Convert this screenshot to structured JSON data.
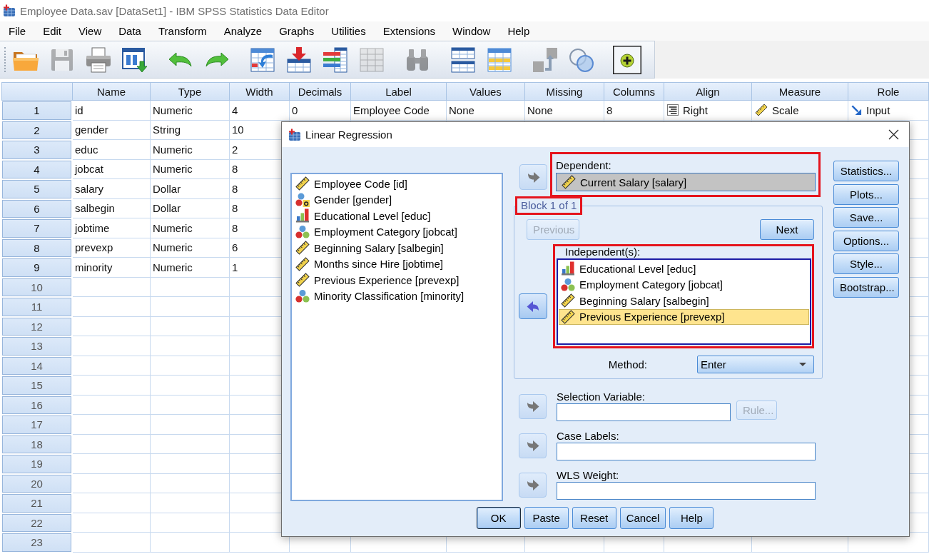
{
  "window": {
    "title": "Employee Data.sav [DataSet1] - IBM SPSS Statistics Data Editor"
  },
  "menu": [
    "File",
    "Edit",
    "View",
    "Data",
    "Transform",
    "Analyze",
    "Graphs",
    "Utilities",
    "Extensions",
    "Window",
    "Help"
  ],
  "toolbar": {
    "groups": [
      [
        {
          "kind": "folder",
          "disabled": false,
          "pressed": false
        },
        {
          "kind": "disk",
          "disabled": true,
          "pressed": false
        },
        {
          "kind": "printer",
          "disabled": false,
          "pressed": false
        },
        {
          "kind": "panel",
          "disabled": false,
          "pressed": false
        }
      ],
      [
        {
          "kind": "undo",
          "disabled": false,
          "pressed": false
        },
        {
          "kind": "redo",
          "disabled": false,
          "pressed": false
        }
      ],
      [
        {
          "kind": "jump",
          "disabled": false,
          "pressed": false
        },
        {
          "kind": "insert",
          "disabled": false,
          "pressed": false
        },
        {
          "kind": "columns",
          "disabled": false,
          "pressed": false
        },
        {
          "kind": "grid",
          "disabled": true,
          "pressed": false
        }
      ],
      [
        {
          "kind": "binoculars",
          "disabled": true,
          "pressed": false
        }
      ],
      [
        {
          "kind": "split",
          "disabled": false,
          "pressed": false
        },
        {
          "kind": "sheet",
          "disabled": false,
          "pressed": false
        }
      ],
      [
        {
          "kind": "labels",
          "disabled": false,
          "pressed": false
        },
        {
          "kind": "circles",
          "disabled": false,
          "pressed": false
        }
      ],
      [
        {
          "kind": "plus",
          "disabled": false,
          "pressed": true
        }
      ]
    ]
  },
  "data_editor": {
    "columns": [
      "Name",
      "Type",
      "Width",
      "Decimals",
      "Label",
      "Values",
      "Missing",
      "Columns",
      "Align",
      "Measure",
      "Role"
    ],
    "rows": [
      {
        "number": "1",
        "cells": [
          "id",
          "Numeric",
          "4",
          "0",
          "Employee Code",
          "None",
          "None",
          "8",
          {
            "text": "Right",
            "kind": "align"
          },
          {
            "text": "Scale",
            "kind": "measure"
          },
          {
            "text": "Input",
            "kind": "role"
          }
        ]
      },
      {
        "number": "2",
        "cells": [
          "gender",
          "String",
          "10"
        ]
      },
      {
        "number": "3",
        "cells": [
          "educ",
          "Numeric",
          "2"
        ]
      },
      {
        "number": "4",
        "cells": [
          "jobcat",
          "Numeric",
          "8"
        ]
      },
      {
        "number": "5",
        "cells": [
          "salary",
          "Dollar",
          "8"
        ]
      },
      {
        "number": "6",
        "cells": [
          "salbegin",
          "Dollar",
          "8"
        ]
      },
      {
        "number": "7",
        "cells": [
          "jobtime",
          "Numeric",
          "8"
        ]
      },
      {
        "number": "8",
        "cells": [
          "prevexp",
          "Numeric",
          "6"
        ]
      },
      {
        "number": "9",
        "cells": [
          "minority",
          "Numeric",
          "1"
        ]
      },
      {
        "number": "10"
      },
      {
        "number": "11"
      },
      {
        "number": "12"
      },
      {
        "number": "13"
      },
      {
        "number": "14"
      },
      {
        "number": "15"
      },
      {
        "number": "16"
      },
      {
        "number": "17"
      },
      {
        "number": "18"
      },
      {
        "number": "19"
      },
      {
        "number": "20"
      },
      {
        "number": "21"
      },
      {
        "number": "22"
      },
      {
        "number": "23"
      }
    ]
  },
  "dialog": {
    "title": "Linear Regression",
    "variables": [
      {
        "label": "Employee Code [id]",
        "kind": "scale",
        "selected": false
      },
      {
        "label": "Gender [gender]",
        "kind": "string",
        "selected": false
      },
      {
        "label": "Educational Level [educ]",
        "kind": "ordinal",
        "selected": false
      },
      {
        "label": "Employment Category [jobcat]",
        "kind": "nominal",
        "selected": false
      },
      {
        "label": "Beginning Salary [salbegin]",
        "kind": "scale",
        "selected": false
      },
      {
        "label": "Months since Hire [jobtime]",
        "kind": "scale",
        "selected": false
      },
      {
        "label": "Previous Experience [prevexp]",
        "kind": "scale",
        "selected": false
      },
      {
        "label": "Minority Classification [minority]",
        "kind": "nominal",
        "selected": false
      }
    ],
    "dependent": {
      "label": "Dependent:",
      "highlighted": true,
      "move": {
        "kind": "forward",
        "active": false
      },
      "variable": {
        "label": "Current Salary [salary]",
        "kind": "scale"
      }
    },
    "block": {
      "label": "Block 1 of 1",
      "highlighted": true,
      "previous": {
        "label": "Previous",
        "disabled": true
      },
      "next": {
        "label": "Next",
        "disabled": false
      },
      "independents": {
        "label": "Independent(s):",
        "highlighted": true,
        "move": {
          "kind": "back",
          "active": true
        },
        "variables": [
          {
            "label": "Educational Level [educ]",
            "kind": "ordinal",
            "selected": false
          },
          {
            "label": "Employment Category [jobcat]",
            "kind": "nominal",
            "selected": false
          },
          {
            "label": "Beginning Salary [salbegin]",
            "kind": "scale",
            "selected": false
          },
          {
            "label": "Previous Experience [prevexp]",
            "kind": "scale",
            "selected": true
          }
        ]
      },
      "method": {
        "label": "Method:",
        "value": "Enter"
      }
    },
    "selection_variable": {
      "label": "Selection Variable:",
      "move": {
        "kind": "forward",
        "active": false
      },
      "rule": {
        "label": "Rule...",
        "disabled": true
      }
    },
    "case_labels": {
      "label": "Case Labels:",
      "move": {
        "kind": "forward",
        "active": false
      }
    },
    "wls_weight": {
      "label": "WLS Weight:",
      "move": {
        "kind": "forward",
        "active": false
      }
    },
    "side_buttons": [
      "Statistics...",
      "Plots...",
      "Save...",
      "Options...",
      "Style...",
      "Bootstrap..."
    ],
    "buttons": [
      {
        "label": "OK",
        "default": true
      },
      {
        "label": "Paste",
        "default": false
      },
      {
        "label": "Reset",
        "default": false
      },
      {
        "label": "Cancel",
        "default": false
      },
      {
        "label": "Help",
        "default": false
      }
    ]
  }
}
